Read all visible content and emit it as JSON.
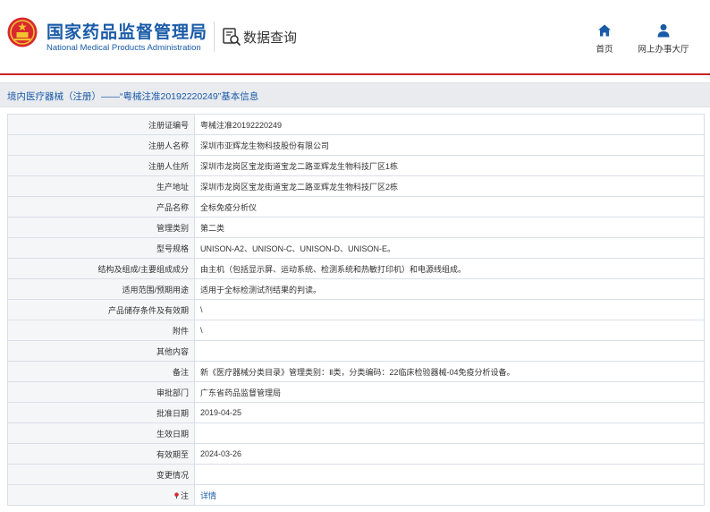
{
  "brand": {
    "name_cn": "国家药品监督管理局",
    "name_en": "National Medical Products Administration"
  },
  "query": {
    "label": "数据查询",
    "icon": "search-document-icon"
  },
  "nav": {
    "home": {
      "label": "首页",
      "icon": "home-icon"
    },
    "office": {
      "label": "网上办事大厅",
      "icon": "user-icon"
    }
  },
  "breadcrumb": "境内医疗器械（注册）——“粤械注准20192220249”基本信息",
  "colors": {
    "brand_blue": "#1a5ba8",
    "accent_red": "#c8231e",
    "label_bg": "#f5f6f8"
  },
  "rows": [
    {
      "label": "注册证编号",
      "value": "粤械注准20192220249"
    },
    {
      "label": "注册人名称",
      "value": "深圳市亚辉龙生物科技股份有限公司"
    },
    {
      "label": "注册人住所",
      "value": "深圳市龙岗区宝龙街道宝龙二路亚辉龙生物科技厂区1栋"
    },
    {
      "label": "生产地址",
      "value": "深圳市龙岗区宝龙街道宝龙二路亚辉龙生物科技厂区2栋"
    },
    {
      "label": "产品名称",
      "value": "全标免疫分析仪"
    },
    {
      "label": "管理类别",
      "value": "第二类"
    },
    {
      "label": "型号规格",
      "value": "UNISON-A2、UNISON-C、UNISON-D、UNISON-E。"
    },
    {
      "label": "结构及组成/主要组成成分",
      "value": "由主机（包括显示屏、运动系统、检测系统和热敏打印机）和电源线组成。"
    },
    {
      "label": "适用范围/预期用途",
      "value": "适用于全标检测试剂结果的判读。"
    },
    {
      "label": "产品储存条件及有效期",
      "value": "\\"
    },
    {
      "label": "附件",
      "value": "\\"
    },
    {
      "label": "其他内容",
      "value": ""
    },
    {
      "label": "备注",
      "value": "新《医疗器械分类目录》管理类别：Ⅱ类，分类编码：22临床检验器械-04免疫分析设备。"
    },
    {
      "label": "审批部门",
      "value": "广东省药品监督管理局"
    },
    {
      "label": "批准日期",
      "value": "2019-04-25"
    },
    {
      "label": "生效日期",
      "value": ""
    },
    {
      "label": "有效期至",
      "value": "2024-03-26"
    },
    {
      "label": "变更情况",
      "value": ""
    }
  ],
  "note_row": {
    "label": "注",
    "link": "详情",
    "icon": "pin-icon"
  }
}
